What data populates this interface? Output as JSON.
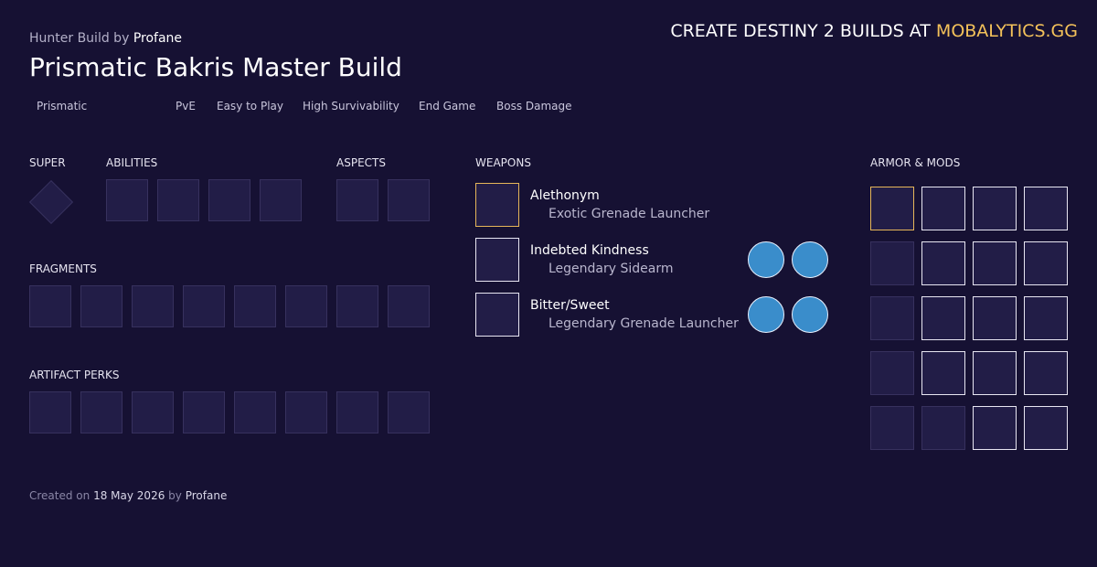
{
  "header": {
    "subtitle_prefix": "Hunter Build by",
    "subtitle_author": "Profane",
    "title": "Prismatic Bakris Master Build",
    "promo_text": "CREATE DESTINY 2 BUILDS AT",
    "promo_brand": "MOBALYTICS.GG",
    "brand_color": "#f4c25a"
  },
  "tags": [
    "Prismatic",
    "PvE",
    "Easy to Play",
    "High Survivability",
    "End Game",
    "Boss Damage"
  ],
  "sections": {
    "super": "SUPER",
    "abilities": "ABILITIES",
    "aspects": "ASPECTS",
    "weapons": "WEAPONS",
    "armor": "ARMOR & MODS",
    "fragments": "FRAGMENTS",
    "artifact": "ARTIFACT PERKS"
  },
  "weapons": [
    {
      "name": "Alethonym",
      "type": "Exotic Grenade Launcher"
    },
    {
      "name": "Indebted Kindness",
      "type": "Legendary Sidearm"
    },
    {
      "name": "Bitter/Sweet",
      "type": "Legendary Grenade Launcher"
    }
  ],
  "footer": {
    "created_prefix": "Created on",
    "date": "18 May 2026",
    "by": "by",
    "author": "Profane"
  }
}
